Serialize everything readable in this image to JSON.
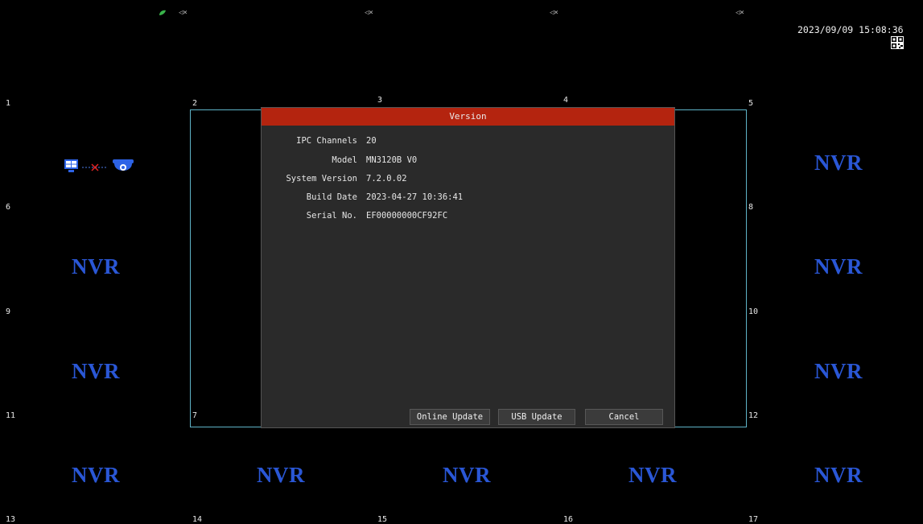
{
  "status": {
    "datetime": "2023/09/09 15:08:36"
  },
  "channels": {
    "c1": "1",
    "c2": "2",
    "c3": "3",
    "c4": "4",
    "c5": "5",
    "c6": "6",
    "c7": "7",
    "c8": "8",
    "c9": "9",
    "c10": "10",
    "c11": "11",
    "c12": "12",
    "c13": "13",
    "c14": "14",
    "c15": "15",
    "c16": "16",
    "c17": "17"
  },
  "placeholder_text": "NVR",
  "icons": {
    "speaker": "speaker-muted-icon",
    "leaf": "leaf-icon",
    "qr": "qr-code-icon",
    "monitor": "monitor-icon",
    "disconnect": "disconnect-icon",
    "camera": "dome-camera-icon"
  },
  "colors": {
    "title_bar": "#b4240f",
    "nvr_text": "#2a57d6",
    "selection_border": "#5fb4c8"
  },
  "dialog": {
    "title": "Version",
    "fields": {
      "ipc_channels_label": "IPC Channels",
      "ipc_channels_value": "20",
      "model_label": "Model",
      "model_value": "MN3120B V0",
      "system_version_label": "System Version",
      "system_version_value": "7.2.0.02",
      "build_date_label": "Build Date",
      "build_date_value": "2023-04-27 10:36:41",
      "serial_label": "Serial No.",
      "serial_value": "EF00000000CF92FC"
    },
    "buttons": {
      "online_update": "Online Update",
      "usb_update": "USB Update",
      "cancel": "Cancel"
    }
  }
}
